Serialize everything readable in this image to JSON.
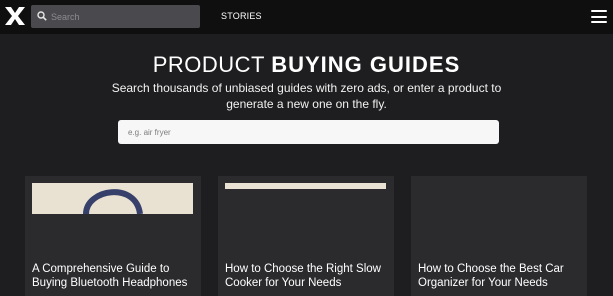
{
  "header": {
    "logo": "X",
    "search": {
      "placeholder": "Search",
      "value": ""
    },
    "nav": {
      "stories_label": "STORIES"
    },
    "menu_icon": "hamburger-icon"
  },
  "hero": {
    "title_light": "PRODUCT",
    "title_bold": "BUYING GUIDES",
    "subtitle": "Search thousands of unbiased guides with zero ads, or enter a product to generate a new one on the fly.",
    "search": {
      "placeholder": "e.g. air fryer",
      "value": ""
    }
  },
  "cards": [
    {
      "title": "A Comprehensive Guide to Buying Bluetooth Headphones"
    },
    {
      "title": "How to Choose the Right Slow Cooker for Your Needs"
    },
    {
      "title": "How to Choose the Best Car Organizer for Your Needs"
    }
  ],
  "colors": {
    "background": "#1e1e20",
    "topbar": "#0f0f10",
    "card": "#2b2b2e",
    "accent_image": "#e9e1d1",
    "headphone": "#36406a"
  }
}
